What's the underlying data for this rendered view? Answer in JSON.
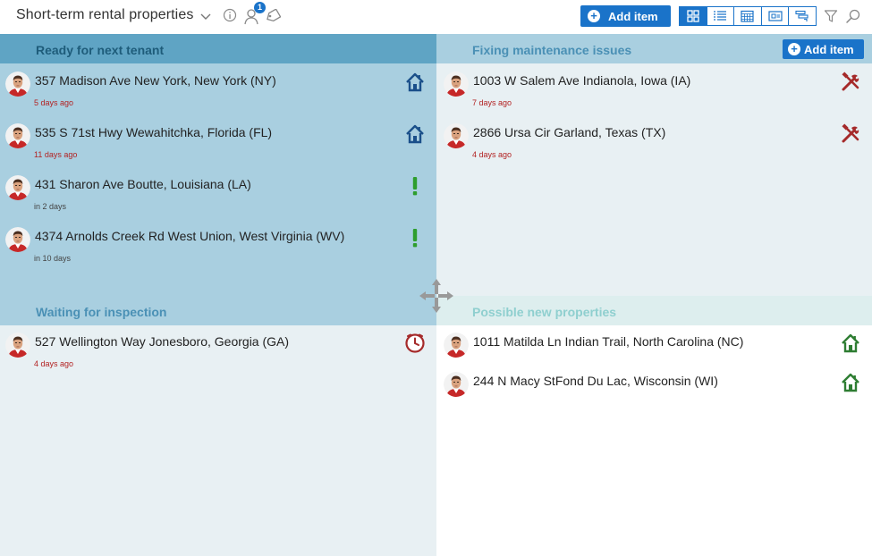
{
  "header": {
    "title": "Short-term rental properties",
    "user_badge": "1",
    "add_item_label": "Add item"
  },
  "colors": {
    "accent": "#1a73c9",
    "late": "#b22222",
    "house_blue": "#1a4f8a",
    "house_green": "#2e7d32",
    "exclaim": "#2e9e2e",
    "tools": "#a52a2a"
  },
  "view_buttons": [
    "board-view-icon",
    "list-view-icon",
    "calendar-view-icon",
    "card-view-icon",
    "timeline-view-icon"
  ],
  "quadrants": {
    "ready": {
      "title": "Ready for next tenant",
      "items": [
        {
          "address": "357 Madison Ave New York, New York (NY)",
          "when": "5 days ago",
          "status": "house-blue-icon"
        },
        {
          "address": "535 S 71st Hwy Wewahitchka, Florida (FL)",
          "when": "11 days ago",
          "status": "house-blue-icon"
        },
        {
          "address": "431 Sharon Ave Boutte, Louisiana (LA)",
          "when": "in 2 days",
          "status": "exclamation-icon"
        },
        {
          "address": "4374 Arnolds Creek Rd West Union, West Virginia (WV)",
          "when": "in 10 days",
          "status": "exclamation-icon"
        }
      ]
    },
    "fixing": {
      "title": "Fixing maintenance issues",
      "add_label": "Add item",
      "items": [
        {
          "address": "1003 W Salem Ave Indianola, Iowa (IA)",
          "when": "7 days ago",
          "status": "tools-icon"
        },
        {
          "address": "2866 Ursa Cir Garland, Texas (TX)",
          "when": "4 days ago",
          "status": "tools-icon"
        }
      ]
    },
    "waiting": {
      "title": "Waiting for inspection",
      "items": [
        {
          "address": "527 Wellington Way Jonesboro, Georgia (GA)",
          "when": "4 days ago",
          "status": "clock-icon"
        }
      ]
    },
    "possible": {
      "title": "Possible new properties",
      "items": [
        {
          "address": "1011 Matilda Ln Indian Trail, North Carolina (NC)",
          "when": "",
          "status": "house-green-icon"
        },
        {
          "address": "244 N Macy StFond Du Lac, Wisconsin (WI)",
          "when": "",
          "status": "house-green-icon"
        }
      ]
    }
  }
}
